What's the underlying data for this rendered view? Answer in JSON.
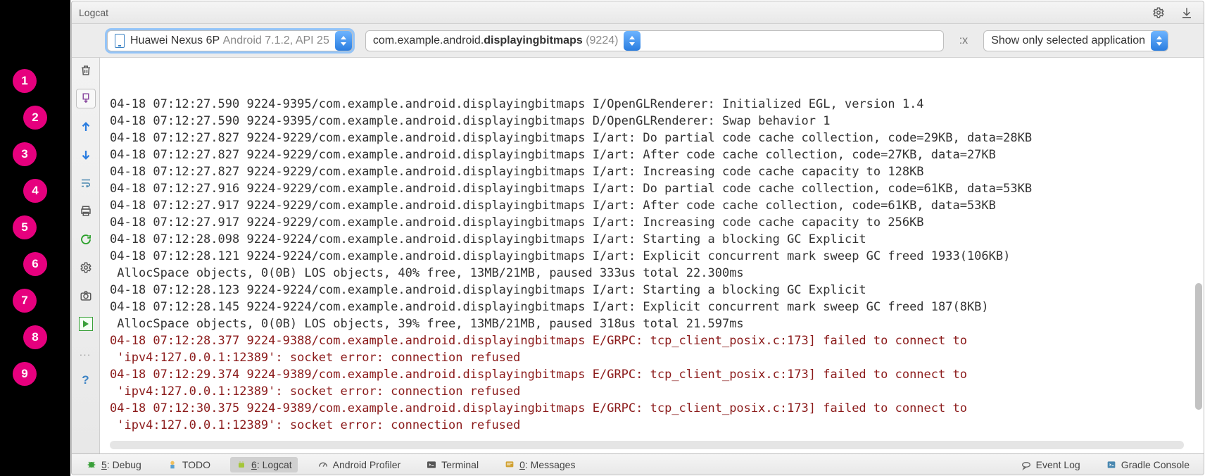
{
  "title": "Logcat",
  "device_select": {
    "prefix": "Huawei Nexus 6P",
    "suffix": "Android 7.1.2, API 25"
  },
  "app_select": {
    "prefix": "com.example.android.",
    "bold": "displayingbitmaps",
    "pid": "(9224)"
  },
  "regex_label": ":x",
  "scope_select": "Show only selected application",
  "callouts": [
    "1",
    "2",
    "3",
    "4",
    "5",
    "6",
    "7",
    "8",
    "9"
  ],
  "log_lines": [
    {
      "lvl": "i",
      "text": "04-18 07:12:27.590 9224-9395/com.example.android.displayingbitmaps I/OpenGLRenderer: Initialized EGL, version 1.4"
    },
    {
      "lvl": "d",
      "text": "04-18 07:12:27.590 9224-9395/com.example.android.displayingbitmaps D/OpenGLRenderer: Swap behavior 1"
    },
    {
      "lvl": "i",
      "text": "04-18 07:12:27.827 9224-9229/com.example.android.displayingbitmaps I/art: Do partial code cache collection, code=29KB, data=28KB"
    },
    {
      "lvl": "i",
      "text": "04-18 07:12:27.827 9224-9229/com.example.android.displayingbitmaps I/art: After code cache collection, code=27KB, data=27KB"
    },
    {
      "lvl": "i",
      "text": "04-18 07:12:27.827 9224-9229/com.example.android.displayingbitmaps I/art: Increasing code cache capacity to 128KB"
    },
    {
      "lvl": "i",
      "text": "04-18 07:12:27.916 9224-9229/com.example.android.displayingbitmaps I/art: Do partial code cache collection, code=61KB, data=53KB"
    },
    {
      "lvl": "i",
      "text": "04-18 07:12:27.917 9224-9229/com.example.android.displayingbitmaps I/art: After code cache collection, code=61KB, data=53KB"
    },
    {
      "lvl": "i",
      "text": "04-18 07:12:27.917 9224-9229/com.example.android.displayingbitmaps I/art: Increasing code cache capacity to 256KB"
    },
    {
      "lvl": "i",
      "text": "04-18 07:12:28.098 9224-9224/com.example.android.displayingbitmaps I/art: Starting a blocking GC Explicit"
    },
    {
      "lvl": "i",
      "text": "04-18 07:12:28.121 9224-9224/com.example.android.displayingbitmaps I/art: Explicit concurrent mark sweep GC freed 1933(106KB)"
    },
    {
      "lvl": "i",
      "text": " AllocSpace objects, 0(0B) LOS objects, 40% free, 13MB/21MB, paused 333us total 22.300ms"
    },
    {
      "lvl": "i",
      "text": "04-18 07:12:28.123 9224-9224/com.example.android.displayingbitmaps I/art: Starting a blocking GC Explicit"
    },
    {
      "lvl": "i",
      "text": "04-18 07:12:28.145 9224-9224/com.example.android.displayingbitmaps I/art: Explicit concurrent mark sweep GC freed 187(8KB)"
    },
    {
      "lvl": "i",
      "text": " AllocSpace objects, 0(0B) LOS objects, 39% free, 13MB/21MB, paused 318us total 21.597ms"
    },
    {
      "lvl": "e",
      "text": "04-18 07:12:28.377 9224-9388/com.example.android.displayingbitmaps E/GRPC: tcp_client_posix.c:173] failed to connect to"
    },
    {
      "lvl": "e",
      "text": " 'ipv4:127.0.0.1:12389': socket error: connection refused"
    },
    {
      "lvl": "e",
      "text": "04-18 07:12:29.374 9224-9389/com.example.android.displayingbitmaps E/GRPC: tcp_client_posix.c:173] failed to connect to"
    },
    {
      "lvl": "e",
      "text": " 'ipv4:127.0.0.1:12389': socket error: connection refused"
    },
    {
      "lvl": "e",
      "text": "04-18 07:12:30.375 9224-9389/com.example.android.displayingbitmaps E/GRPC: tcp_client_posix.c:173] failed to connect to"
    },
    {
      "lvl": "e",
      "text": " 'ipv4:127.0.0.1:12389': socket error: connection refused"
    }
  ],
  "tabs": {
    "debug": "5: Debug",
    "todo": "TODO",
    "logcat": "6: Logcat",
    "profiler": "Android Profiler",
    "terminal": "Terminal",
    "messages": "0: Messages",
    "eventlog": "Event Log",
    "gradle": "Gradle Console"
  },
  "overflow_label": "...",
  "help_label": "?"
}
